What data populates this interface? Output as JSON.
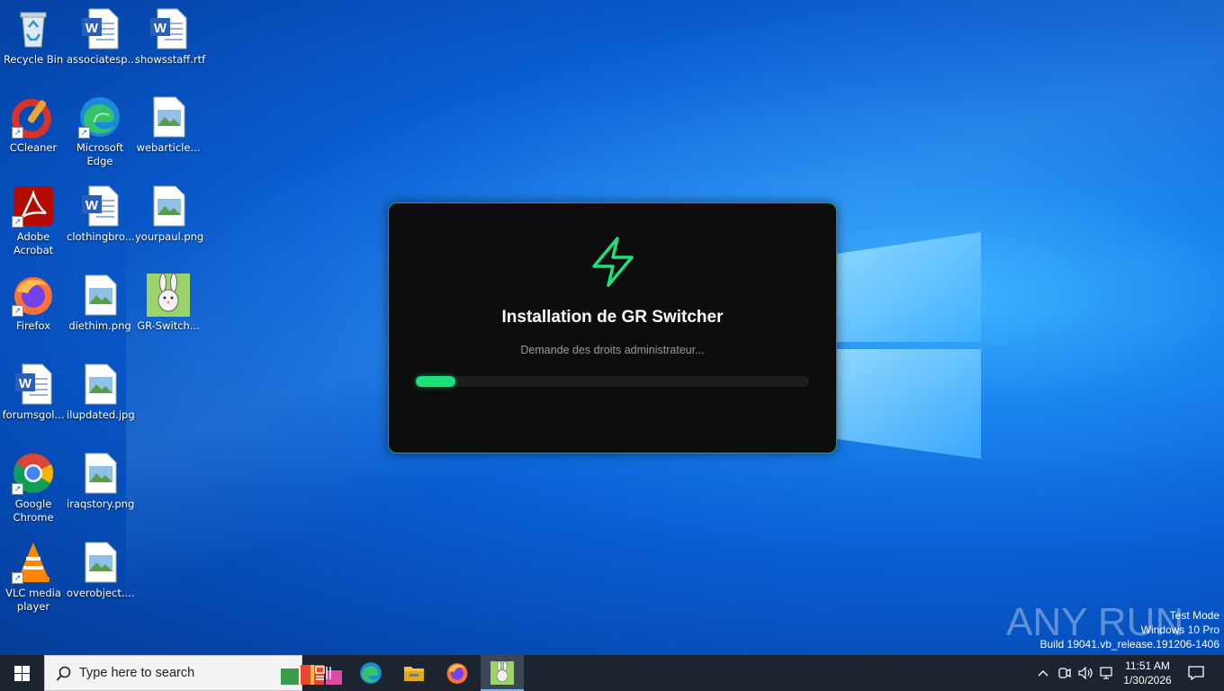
{
  "desktop": {
    "icons": [
      {
        "label": "Recycle Bin",
        "icon": "recycle-bin-icon"
      },
      {
        "label": "associatesp...",
        "icon": "word-doc-icon"
      },
      {
        "label": "showsstaff.rtf",
        "icon": "word-doc-icon"
      },
      {
        "label": "CCleaner",
        "icon": "ccleaner-icon"
      },
      {
        "label": "Microsoft Edge",
        "icon": "edge-icon"
      },
      {
        "label": "webarticle...",
        "icon": "image-file-icon"
      },
      {
        "label": "Adobe Acrobat",
        "icon": "acrobat-icon"
      },
      {
        "label": "clothingbro...",
        "icon": "word-doc-icon"
      },
      {
        "label": "yourpaul.png",
        "icon": "image-file-icon"
      },
      {
        "label": "Firefox",
        "icon": "firefox-icon"
      },
      {
        "label": "diethim.png",
        "icon": "image-file-icon"
      },
      {
        "label": "GR-Switch...",
        "icon": "gr-switcher-icon"
      },
      {
        "label": "forumsgol...",
        "icon": "word-doc-icon"
      },
      {
        "label": "ilupdated.jpg",
        "icon": "image-file-icon"
      },
      {
        "label": "Google Chrome",
        "icon": "chrome-icon"
      },
      {
        "label": "iraqstory.png",
        "icon": "image-file-icon"
      },
      {
        "label": "VLC media player",
        "icon": "vlc-icon"
      },
      {
        "label": "overobject....",
        "icon": "image-file-icon"
      }
    ]
  },
  "dialog": {
    "title": "Installation de GR Switcher",
    "status": "Demande des droits administrateur...",
    "progress": 0.1,
    "accent": "#1ee07a",
    "icon": "lightning-bolt-icon"
  },
  "watermark": {
    "line1": "Test Mode",
    "line2": "Windows 10 Pro",
    "line3": "Build 19041.vb_release.191206-1406",
    "brand": "ANY RUN"
  },
  "taskbar": {
    "search_placeholder": "Type here to search",
    "pinned": [
      "task-view-icon",
      "edge-icon",
      "file-explorer-icon",
      "firefox-icon",
      "gr-switcher-icon"
    ],
    "clock_time": "11:51 AM",
    "clock_date": "1/30/2026"
  }
}
